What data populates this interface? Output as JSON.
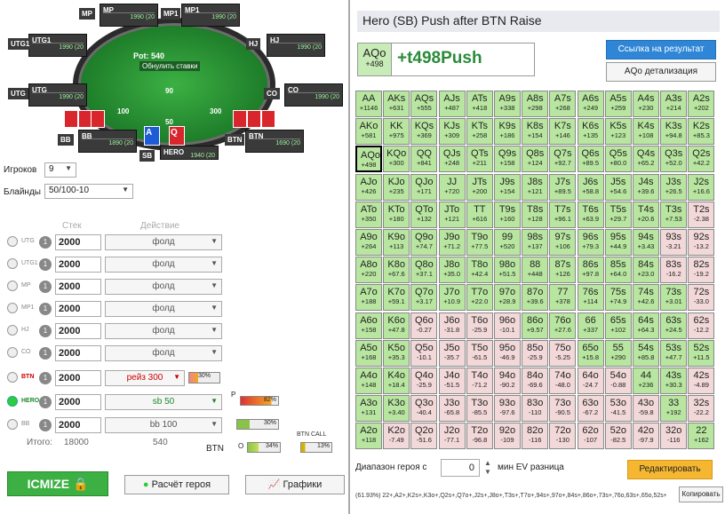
{
  "seats": [
    {
      "pos": "MP",
      "name": "MP",
      "stack": "1990 (20"
    },
    {
      "pos": "MP1",
      "name": "MP1",
      "stack": "1990 (20"
    },
    {
      "pos": "UTG1",
      "name": "UTG1",
      "stack": "1990 (20"
    },
    {
      "pos": "HJ",
      "name": "HJ",
      "stack": "1990 (20"
    },
    {
      "pos": "UTG",
      "name": "UTG",
      "stack": "1990 (20"
    },
    {
      "pos": "CO",
      "name": "CO",
      "stack": "1990 (20"
    },
    {
      "pos": "BB",
      "name": "BB",
      "stack": "1890 (20"
    },
    {
      "pos": "BTN",
      "name": "BTN",
      "stack": "1690 (20"
    },
    {
      "pos": "SB",
      "name": "HERO",
      "stack": "1940 (20"
    }
  ],
  "table": {
    "pot": "Pot: 540",
    "reset": "Обнулить ставки",
    "chip_top": "90",
    "chip_left": "100",
    "chip_mid": "50",
    "chip_right": "300",
    "hero_cards": [
      "A",
      "Q"
    ],
    "watermark": "ICMIZER"
  },
  "controls": {
    "players_label": "Игроков",
    "players_value": "9",
    "blinds_label": "Блайнды",
    "blinds_value": "50/100-10"
  },
  "headers": {
    "stack": "Стек",
    "action": "Действие"
  },
  "rows": [
    {
      "pos": "UTG",
      "n": "1",
      "stack": "2000",
      "action": "фолд"
    },
    {
      "pos": "UTG1",
      "n": "1",
      "stack": "2000",
      "action": "фолд"
    },
    {
      "pos": "MP",
      "n": "1",
      "stack": "2000",
      "action": "фолд"
    },
    {
      "pos": "MP1",
      "n": "1",
      "stack": "2000",
      "action": "фолд"
    },
    {
      "pos": "HJ",
      "n": "1",
      "stack": "2000",
      "action": "фолд"
    },
    {
      "pos": "CO",
      "n": "1",
      "stack": "2000",
      "action": "фолд"
    },
    {
      "pos": "BTN",
      "n": "1",
      "stack": "2000",
      "action": "рейз 300",
      "pct": "30%"
    },
    {
      "pos": "HERO",
      "n": "1",
      "stack": "2000",
      "action": "sb 50"
    },
    {
      "pos": "BB",
      "n": "1",
      "stack": "2000",
      "action": "bb 100"
    }
  ],
  "totals": {
    "label": "Итого:",
    "stack": "18000",
    "pot": "540",
    "btn": "BTN"
  },
  "mini": {
    "p_label": "P",
    "p_pct": "82%",
    "mid_pct": "30%",
    "o_label": "O",
    "o_pct": "34%",
    "btn_call": "BTN CALL",
    "call_pct": "13%"
  },
  "buttons": {
    "icmize": "ICMIZE",
    "calc": "Расчёт героя",
    "charts": "Графики"
  },
  "right": {
    "title": "Hero (SB) Push after BTN Raise",
    "hand": "AQo",
    "hand_val": "+498",
    "hand_ev": "+t498Push",
    "link_btn": "Ссылка на результат",
    "detail_btn": "AQo детализация",
    "range_label": "Диапазон героя с",
    "range_value": "0",
    "range_suffix": "мин EV разница",
    "edit_btn": "Редактировать",
    "footer": "(61.93%) 22+,A2+,K2s+,K3o+,Q2s+,Q7o+,J2s+,J8o+,T3s+,T7o+,94s+,97o+,84s+,86o+,73s+,76o,63s+,65o,52s+,43s",
    "copy_btn": "Копировать"
  },
  "grid": [
    [
      "AA",
      "+1146",
      "p"
    ],
    [
      "AKs",
      "+631",
      "p"
    ],
    [
      "AQs",
      "+555",
      "p"
    ],
    [
      "AJs",
      "+487",
      "p"
    ],
    [
      "ATs",
      "+418",
      "p"
    ],
    [
      "A9s",
      "+338",
      "p"
    ],
    [
      "A8s",
      "+298",
      "p"
    ],
    [
      "A7s",
      "+268",
      "p"
    ],
    [
      "A6s",
      "+249",
      "p"
    ],
    [
      "A5s",
      "+259",
      "p"
    ],
    [
      "A4s",
      "+230",
      "p"
    ],
    [
      "A3s",
      "+214",
      "p"
    ],
    [
      "A2s",
      "+202",
      "p"
    ],
    [
      "AKo",
      "+581",
      "p"
    ],
    [
      "KK",
      "+975",
      "p"
    ],
    [
      "KQs",
      "+369",
      "p"
    ],
    [
      "KJs",
      "+309",
      "p"
    ],
    [
      "KTs",
      "+258",
      "p"
    ],
    [
      "K9s",
      "+186",
      "p"
    ],
    [
      "K8s",
      "+154",
      "p"
    ],
    [
      "K7s",
      "+146",
      "p"
    ],
    [
      "K6s",
      "+135",
      "p"
    ],
    [
      "K5s",
      "+123",
      "p"
    ],
    [
      "K4s",
      "+108",
      "p"
    ],
    [
      "K3s",
      "+94.8",
      "p"
    ],
    [
      "K2s",
      "+85.3",
      "p"
    ],
    [
      "AQo",
      "+498",
      "p"
    ],
    [
      "KQo",
      "+300",
      "p"
    ],
    [
      "QQ",
      "+841",
      "p"
    ],
    [
      "QJs",
      "+248",
      "p"
    ],
    [
      "QTs",
      "+211",
      "p"
    ],
    [
      "Q9s",
      "+158",
      "p"
    ],
    [
      "Q8s",
      "+124",
      "p"
    ],
    [
      "Q7s",
      "+92.7",
      "p"
    ],
    [
      "Q6s",
      "+89.5",
      "p"
    ],
    [
      "Q5s",
      "+80.0",
      "p"
    ],
    [
      "Q4s",
      "+65.2",
      "p"
    ],
    [
      "Q3s",
      "+52.0",
      "p"
    ],
    [
      "Q2s",
      "+42.2",
      "p"
    ],
    [
      "AJo",
      "+426",
      "p"
    ],
    [
      "KJo",
      "+235",
      "p"
    ],
    [
      "QJo",
      "+171",
      "p"
    ],
    [
      "JJ",
      "+720",
      "p"
    ],
    [
      "JTs",
      "+200",
      "p"
    ],
    [
      "J9s",
      "+154",
      "p"
    ],
    [
      "J8s",
      "+121",
      "p"
    ],
    [
      "J7s",
      "+89.5",
      "p"
    ],
    [
      "J6s",
      "+58.8",
      "p"
    ],
    [
      "J5s",
      "+54.6",
      "p"
    ],
    [
      "J4s",
      "+39.6",
      "p"
    ],
    [
      "J3s",
      "+26.5",
      "p"
    ],
    [
      "J2s",
      "+16.6",
      "p"
    ],
    [
      "ATo",
      "+350",
      "p"
    ],
    [
      "KTo",
      "+180",
      "p"
    ],
    [
      "QTo",
      "+132",
      "p"
    ],
    [
      "JTo",
      "+121",
      "p"
    ],
    [
      "TT",
      "+616",
      "p"
    ],
    [
      "T9s",
      "+160",
      "p"
    ],
    [
      "T8s",
      "+128",
      "p"
    ],
    [
      "T7s",
      "+96.1",
      "p"
    ],
    [
      "T6s",
      "+63.9",
      "p"
    ],
    [
      "T5s",
      "+29.7",
      "p"
    ],
    [
      "T4s",
      "+20.6",
      "p"
    ],
    [
      "T3s",
      "+7.53",
      "p"
    ],
    [
      "T2s",
      "-2.38",
      "f"
    ],
    [
      "A9o",
      "+264",
      "p"
    ],
    [
      "K9o",
      "+113",
      "p"
    ],
    [
      "Q9o",
      "+74.7",
      "p"
    ],
    [
      "J9o",
      "+71.2",
      "p"
    ],
    [
      "T9o",
      "+77.5",
      "p"
    ],
    [
      "99",
      "+520",
      "p"
    ],
    [
      "98s",
      "+137",
      "p"
    ],
    [
      "97s",
      "+106",
      "p"
    ],
    [
      "96s",
      "+79.3",
      "p"
    ],
    [
      "95s",
      "+44.9",
      "p"
    ],
    [
      "94s",
      "+3.43",
      "p"
    ],
    [
      "93s",
      "-3.21",
      "f"
    ],
    [
      "92s",
      "-13.2",
      "f"
    ],
    [
      "A8o",
      "+220",
      "p"
    ],
    [
      "K8o",
      "+67.6",
      "p"
    ],
    [
      "Q8o",
      "+37.1",
      "p"
    ],
    [
      "J8o",
      "+35.0",
      "p"
    ],
    [
      "T8o",
      "+42.4",
      "p"
    ],
    [
      "98o",
      "+51.5",
      "p"
    ],
    [
      "88",
      "+448",
      "p"
    ],
    [
      "87s",
      "+126",
      "p"
    ],
    [
      "86s",
      "+97.8",
      "p"
    ],
    [
      "85s",
      "+64.0",
      "p"
    ],
    [
      "84s",
      "+23.0",
      "p"
    ],
    [
      "83s",
      "-16.2",
      "f"
    ],
    [
      "82s",
      "-19.2",
      "f"
    ],
    [
      "A7o",
      "+188",
      "p"
    ],
    [
      "K7o",
      "+59.1",
      "p"
    ],
    [
      "Q7o",
      "+3.17",
      "p"
    ],
    [
      "J7o",
      "+10.9",
      "p"
    ],
    [
      "T7o",
      "+22.0",
      "p"
    ],
    [
      "97o",
      "+28.9",
      "p"
    ],
    [
      "87o",
      "+39.6",
      "p"
    ],
    [
      "77",
      "+378",
      "p"
    ],
    [
      "76s",
      "+114",
      "p"
    ],
    [
      "75s",
      "+74.9",
      "p"
    ],
    [
      "74s",
      "+42.6",
      "p"
    ],
    [
      "73s",
      "+3.01",
      "p"
    ],
    [
      "72s",
      "-33.0",
      "f"
    ],
    [
      "A6o",
      "+158",
      "p"
    ],
    [
      "K6o",
      "+47.8",
      "p"
    ],
    [
      "Q6o",
      "-0.27",
      "f"
    ],
    [
      "J6o",
      "-31.8",
      "f"
    ],
    [
      "T6o",
      "-25.9",
      "f"
    ],
    [
      "96o",
      "-10.1",
      "f"
    ],
    [
      "86o",
      "+9.57",
      "p"
    ],
    [
      "76o",
      "+27.6",
      "p"
    ],
    [
      "66",
      "+337",
      "p"
    ],
    [
      "65s",
      "+102",
      "p"
    ],
    [
      "64s",
      "+64.3",
      "p"
    ],
    [
      "63s",
      "+24.5",
      "p"
    ],
    [
      "62s",
      "-12.2",
      "f"
    ],
    [
      "A5o",
      "+168",
      "p"
    ],
    [
      "K5o",
      "+35.3",
      "p"
    ],
    [
      "Q5o",
      "-10.1",
      "f"
    ],
    [
      "J5o",
      "-35.7",
      "f"
    ],
    [
      "T5o",
      "-61.5",
      "f"
    ],
    [
      "95o",
      "-46.9",
      "f"
    ],
    [
      "85o",
      "-25.9",
      "f"
    ],
    [
      "75o",
      "-5.25",
      "f"
    ],
    [
      "65o",
      "+15.8",
      "p"
    ],
    [
      "55",
      "+290",
      "p"
    ],
    [
      "54s",
      "+85.8",
      "p"
    ],
    [
      "53s",
      "+47.7",
      "p"
    ],
    [
      "52s",
      "+11.5",
      "p"
    ],
    [
      "A4o",
      "+148",
      "p"
    ],
    [
      "K4o",
      "+18.4",
      "p"
    ],
    [
      "Q4o",
      "-25.9",
      "f"
    ],
    [
      "J4o",
      "-51.5",
      "f"
    ],
    [
      "T4o",
      "-71.2",
      "f"
    ],
    [
      "94o",
      "-90.2",
      "f"
    ],
    [
      "84o",
      "-69.6",
      "f"
    ],
    [
      "74o",
      "-48.0",
      "f"
    ],
    [
      "64o",
      "-24.7",
      "f"
    ],
    [
      "54o",
      "-0.88",
      "f"
    ],
    [
      "44",
      "+236",
      "p"
    ],
    [
      "43s",
      "+30.3",
      "p"
    ],
    [
      "42s",
      "-4.89",
      "f"
    ],
    [
      "A3o",
      "+131",
      "p"
    ],
    [
      "K3o",
      "+3.40",
      "p"
    ],
    [
      "Q3o",
      "-40.4",
      "f"
    ],
    [
      "J3o",
      "-65.8",
      "f"
    ],
    [
      "T3o",
      "-85.5",
      "f"
    ],
    [
      "93o",
      "-97.6",
      "f"
    ],
    [
      "83o",
      "-110",
      "f"
    ],
    [
      "73o",
      "-90.5",
      "f"
    ],
    [
      "63o",
      "-67.2",
      "f"
    ],
    [
      "53o",
      "-41.5",
      "f"
    ],
    [
      "43o",
      "-59.8",
      "f"
    ],
    [
      "33",
      "+192",
      "p"
    ],
    [
      "32s",
      "-22.2",
      "f"
    ],
    [
      "A2o",
      "+118",
      "p"
    ],
    [
      "K2o",
      "-7.49",
      "f"
    ],
    [
      "Q2o",
      "-51.6",
      "f"
    ],
    [
      "J2o",
      "-77.1",
      "f"
    ],
    [
      "T2o",
      "-96.8",
      "f"
    ],
    [
      "92o",
      "-109",
      "f"
    ],
    [
      "82o",
      "-116",
      "f"
    ],
    [
      "72o",
      "-130",
      "f"
    ],
    [
      "62o",
      "-107",
      "f"
    ],
    [
      "52o",
      "-82.5",
      "f"
    ],
    [
      "42o",
      "-97.9",
      "f"
    ],
    [
      "32o",
      "-116",
      "f"
    ],
    [
      "22",
      "+162",
      "p"
    ]
  ]
}
